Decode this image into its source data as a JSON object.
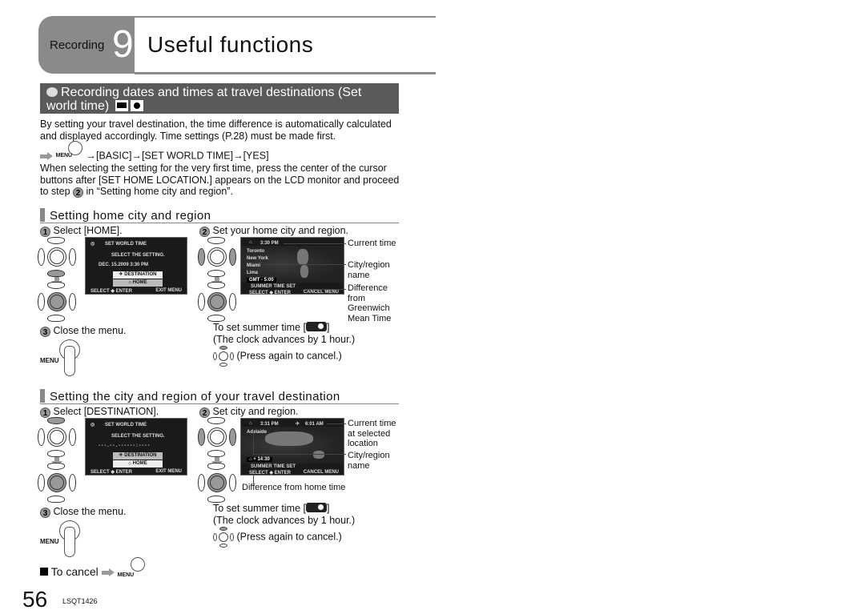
{
  "header": {
    "section": "Recording",
    "number": "9",
    "title": "Useful functions"
  },
  "banner": {
    "icon": "world-time-icon",
    "title": "Recording dates and times at travel destinations (Set world time)",
    "mode_icons": [
      "motion-picture-mode-icon",
      "still-picture-mode-icon"
    ]
  },
  "intro": {
    "paragraph": "By setting your travel destination, the time difference is automatically calculated and displayed accordingly. Time settings (P.28) must be made first.",
    "menu_label": "MENU",
    "menu_path": "→[BASIC]→[SET WORLD TIME]→[YES]",
    "note_before": "When selecting the setting for the very first time, press the center of the cursor buttons after [SET HOME LOCATION.] appears on the LCD monitor and proceed to step",
    "note_step": "2",
    "note_after": "in “Setting home city and region”."
  },
  "home_section": {
    "heading": "Setting home city and region",
    "step1": {
      "num": "1",
      "label": "Select [HOME].",
      "screen": {
        "title": "SET WORLD TIME",
        "prompt": "SELECT THE SETTING.",
        "datetime": "DEC. 15.2009   3:30 PM",
        "option_destination": "DESTINATION",
        "option_home": "HOME",
        "footer_left": "SELECT ◆ ENTER",
        "footer_right": "EXIT MENU"
      }
    },
    "step2": {
      "num": "2",
      "label": "Set your home city and region.",
      "screen": {
        "time": "3:30 PM",
        "cities": [
          "Toronto",
          "New York",
          "Miami",
          "Lima"
        ],
        "gmt": "GMT -  5:00",
        "summer": "SUMMER TIME SET",
        "footer_left": "SELECT ◆ ENTER",
        "footer_right": "CANCEL MENU"
      },
      "annotations": {
        "current_time": "Current time",
        "city_name": "City/region name",
        "gmt_diff": "Difference from Greenwich Mean Time"
      }
    },
    "step3": {
      "num": "3",
      "label": "Close the menu.",
      "menu_label": "MENU"
    },
    "summer": {
      "line1": "To set summer time [",
      "line1_end": "]",
      "line2": "(The clock advances by 1 hour.)",
      "line3": "(Press again to cancel.)"
    }
  },
  "dest_section": {
    "heading": "Setting the city and region of your travel destination",
    "step1": {
      "num": "1",
      "label": "Select [DESTINATION].",
      "screen": {
        "title": "SET WORLD TIME",
        "prompt": "SELECT THE SETTING.",
        "datetime": "- - - . - - . - - - -   - - : - - - -",
        "option_destination": "DESTINATION",
        "option_home": "HOME",
        "footer_left": "SELECT ◆ ENTER",
        "footer_right": "EXIT MENU"
      }
    },
    "step2": {
      "num": "2",
      "label": "Set city and region.",
      "screen": {
        "home_time": "3:31 PM",
        "dest_time": "6:01 AM",
        "city": "Adelaide",
        "diff": "+ 14:30",
        "summer": "SUMMER TIME SET",
        "footer_left": "SELECT ◆ ENTER",
        "footer_right": "CANCEL MENU"
      },
      "annotations": {
        "current_time": "Current time at selected location",
        "city_name": "City/region name",
        "home_diff": "Difference from home time"
      }
    },
    "step3": {
      "num": "3",
      "label": "Close the menu.",
      "menu_label": "MENU"
    },
    "summer": {
      "line1": "To set summer time [",
      "line1_end": "]",
      "line2": "(The clock advances by 1 hour.)",
      "line3": "(Press again to cancel.)"
    }
  },
  "cancel": {
    "label": "To cancel",
    "menu_label": "MENU"
  },
  "footer": {
    "page": "56",
    "code": "LSQT1426"
  }
}
